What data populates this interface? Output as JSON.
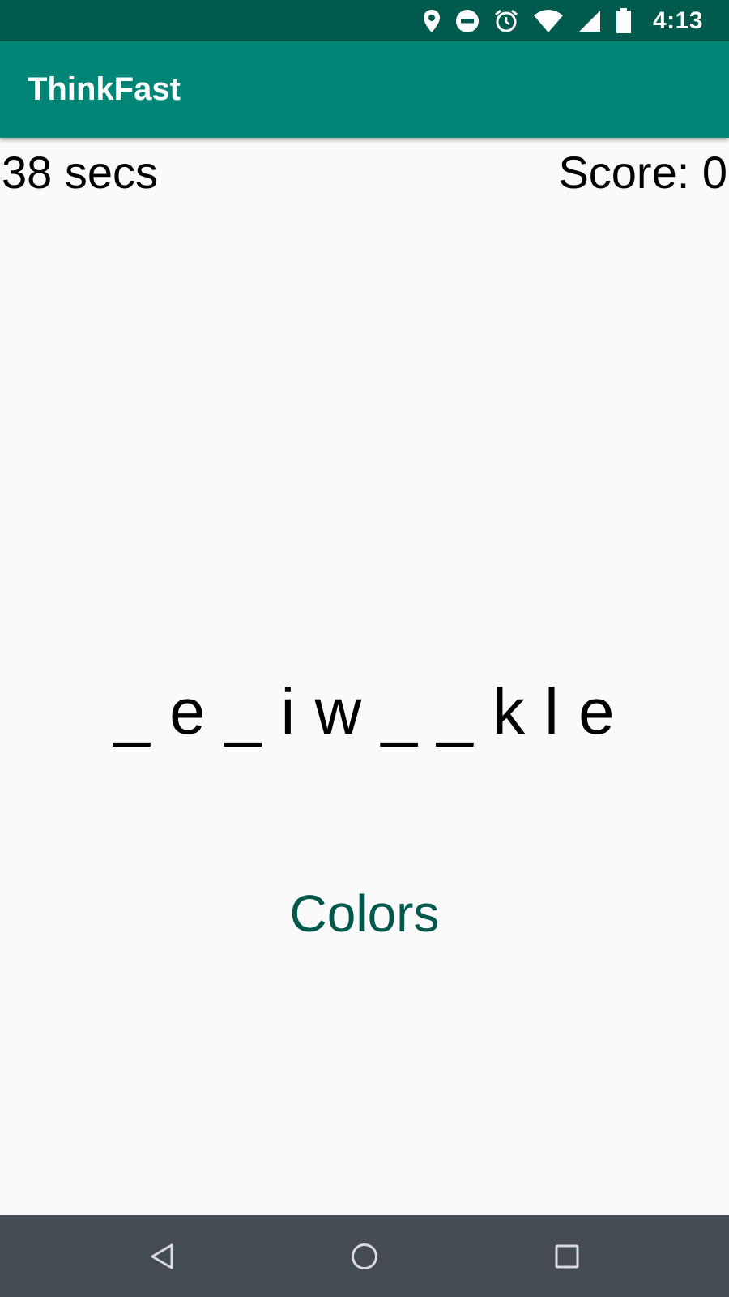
{
  "status_bar": {
    "time": "4:13",
    "icons": [
      "location-icon",
      "do-not-disturb-icon",
      "alarm-icon",
      "wifi-icon",
      "cellular-signal-icon",
      "battery-icon"
    ]
  },
  "app_bar": {
    "title": "ThinkFast"
  },
  "game": {
    "timer": "38 secs",
    "score": "Score: 0",
    "puzzle": "_ e _ i w _ _ k l e",
    "category": "Colors"
  },
  "nav_bar": {
    "icons": [
      "back-icon",
      "home-icon",
      "recents-icon"
    ]
  },
  "colors": {
    "status_bar": "#005a4e",
    "app_bar": "#008577",
    "category_text": "#00574b",
    "nav_bar": "#454b52",
    "background": "#fafafa"
  }
}
